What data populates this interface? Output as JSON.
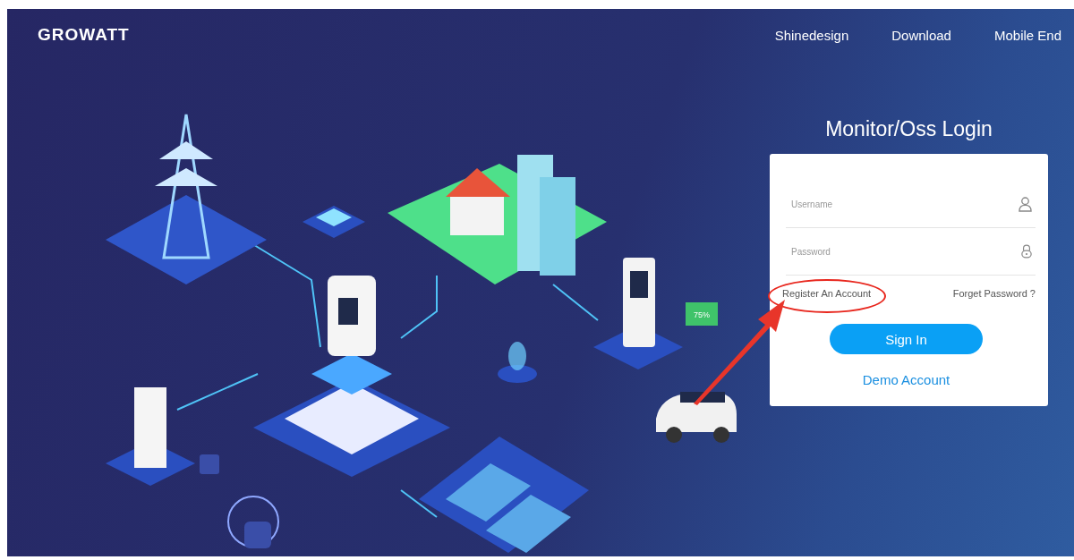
{
  "brand": {
    "logo": "GROWATT"
  },
  "nav": [
    {
      "label": "Shinedesign"
    },
    {
      "label": "Download"
    },
    {
      "label": "Mobile End"
    }
  ],
  "illustration": {
    "battery_label": "75%"
  },
  "login": {
    "title": "Monitor/Oss Login",
    "username": {
      "placeholder": "Username"
    },
    "password": {
      "placeholder": "Password"
    },
    "register_link": "Register An Account",
    "forgot_link": "Forget Password ?",
    "sign_in": "Sign In",
    "demo_link": "Demo Account"
  }
}
